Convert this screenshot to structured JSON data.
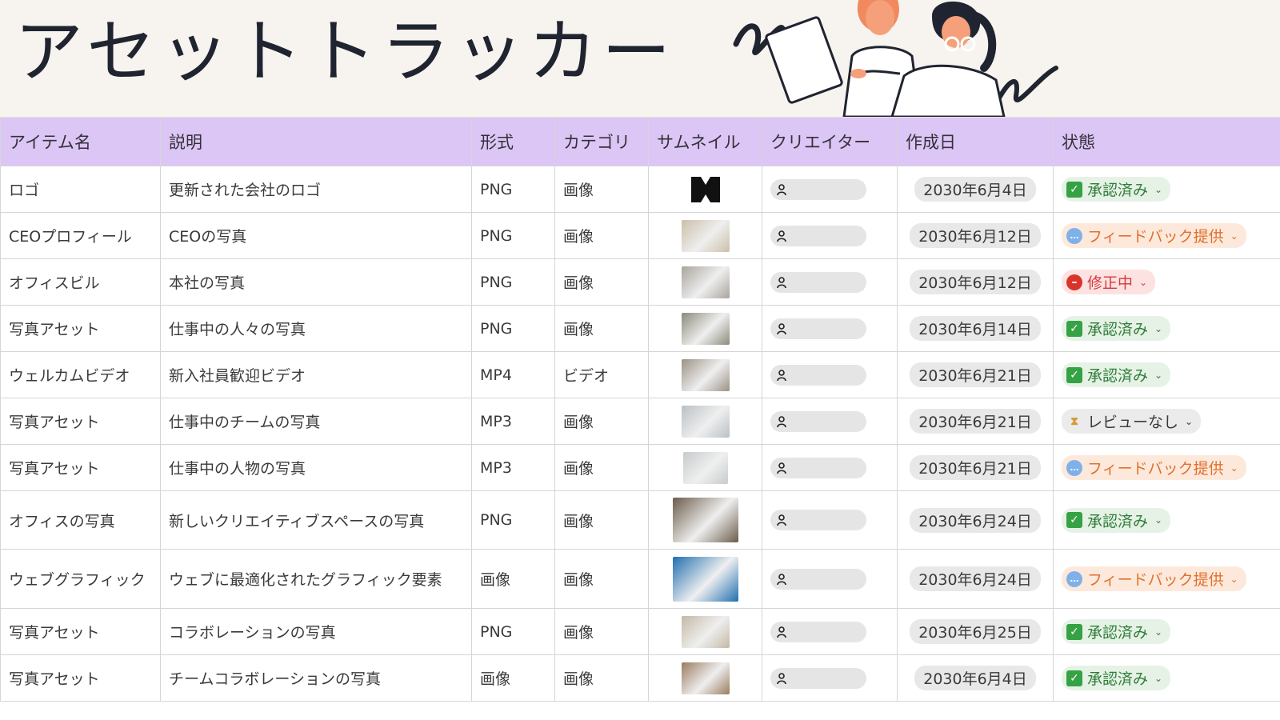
{
  "page": {
    "title": "アセットトラッカー"
  },
  "colors": {
    "header_bg": "#f7f3ef",
    "table_header_bg": "#dcc6f5",
    "approved": "#2f7d3a",
    "feedback": "#e0702b",
    "fixing": "#d63b3b"
  },
  "table": {
    "columns": [
      "アイテム名",
      "説明",
      "形式",
      "カテゴリ",
      "サムネイル",
      "クリエイター",
      "作成日",
      "状態"
    ],
    "rows": [
      {
        "name": "ロゴ",
        "description": "更新された会社のロゴ",
        "format": "PNG",
        "category": "画像",
        "thumbnail": "logo-thumbnail",
        "created": "2030年6月4日",
        "status": "承認済み",
        "status_kind": "approved"
      },
      {
        "name": "CEOプロフィール",
        "description": "CEOの写真",
        "format": "PNG",
        "category": "画像",
        "thumbnail": "photo-thumbnail",
        "created": "2030年6月12日",
        "status": "フィードバック提供",
        "status_kind": "feedback"
      },
      {
        "name": "オフィスビル",
        "description": "本社の写真",
        "format": "PNG",
        "category": "画像",
        "thumbnail": "photo-thumbnail",
        "created": "2030年6月12日",
        "status": "修正中",
        "status_kind": "fixing"
      },
      {
        "name": "写真アセット",
        "description": "仕事中の人々の写真",
        "format": "PNG",
        "category": "画像",
        "thumbnail": "photo-thumbnail",
        "created": "2030年6月14日",
        "status": "承認済み",
        "status_kind": "approved"
      },
      {
        "name": "ウェルカムビデオ",
        "description": "新入社員歓迎ビデオ",
        "format": "MP4",
        "category": "ビデオ",
        "thumbnail": "photo-thumbnail",
        "created": "2030年6月21日",
        "status": "承認済み",
        "status_kind": "approved"
      },
      {
        "name": "写真アセット",
        "description": "仕事中のチームの写真",
        "format": "MP3",
        "category": "画像",
        "thumbnail": "photo-thumbnail",
        "created": "2030年6月21日",
        "status": "レビューなし",
        "status_kind": "none"
      },
      {
        "name": "写真アセット",
        "description": "仕事中の人物の写真",
        "format": "MP3",
        "category": "画像",
        "thumbnail": "photo-thumbnail",
        "created": "2030年6月21日",
        "status": "フィードバック提供",
        "status_kind": "feedback"
      },
      {
        "name": "オフィスの写真",
        "description": "新しいクリエイティブスペースの写真",
        "format": "PNG",
        "category": "画像",
        "thumbnail": "photo-thumbnail",
        "created": "2030年6月24日",
        "status": "承認済み",
        "status_kind": "approved"
      },
      {
        "name": "ウェブグラフィック",
        "description": "ウェブに最適化されたグラフィック要素",
        "format": "画像",
        "category": "画像",
        "thumbnail": "photo-thumbnail",
        "created": "2030年6月24日",
        "status": "フィードバック提供",
        "status_kind": "feedback"
      },
      {
        "name": "写真アセット",
        "description": "コラボレーションの写真",
        "format": "PNG",
        "category": "画像",
        "thumbnail": "photo-thumbnail",
        "created": "2030年6月25日",
        "status": "承認済み",
        "status_kind": "approved"
      },
      {
        "name": "写真アセット",
        "description": "チームコラボレーションの写真",
        "format": "画像",
        "category": "画像",
        "thumbnail": "photo-thumbnail",
        "created": "2030年6月4日",
        "status": "承認済み",
        "status_kind": "approved"
      }
    ]
  }
}
